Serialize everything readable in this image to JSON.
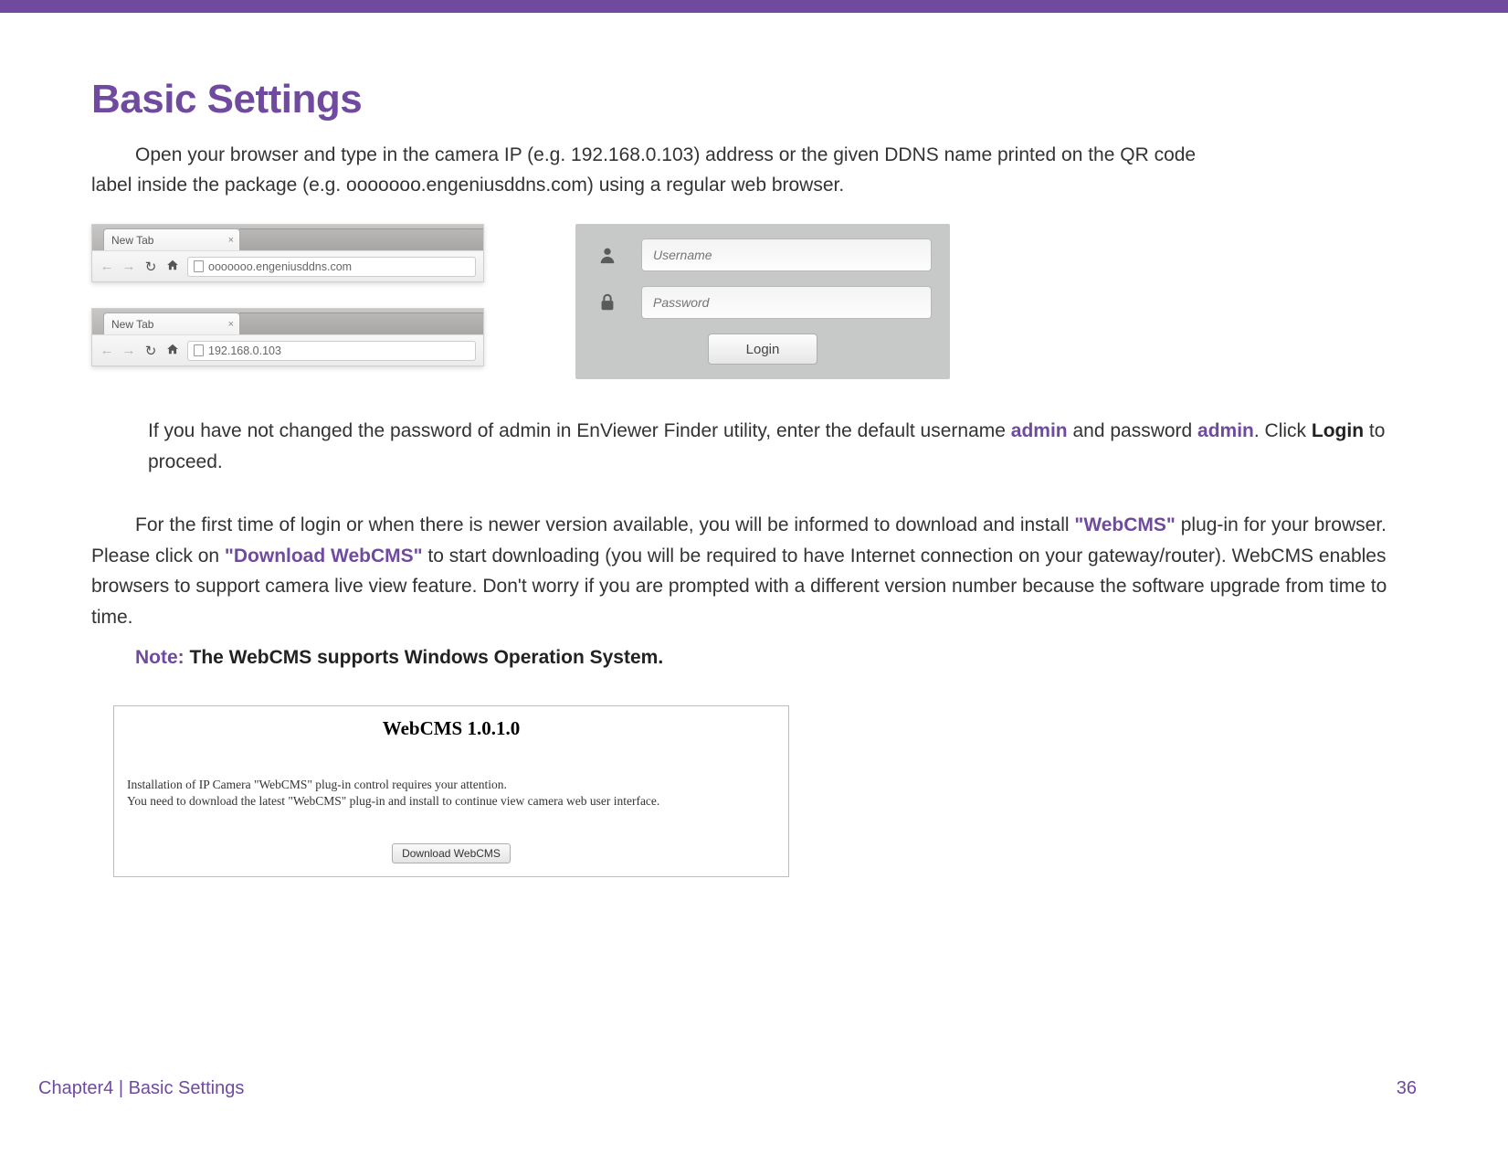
{
  "header": {
    "title": "Basic Settings"
  },
  "intro": {
    "text_a": "Open your browser and type in the camera IP (e.g. 192.168.0.103) address or the given DDNS name printed on the QR code",
    "text_b": "label inside the package (e.g. ooooooo.engeniusddns.com) using a regular web browser."
  },
  "browser1": {
    "tab_label": "New Tab",
    "address": "ooooooo.engeniusddns.com"
  },
  "browser2": {
    "tab_label": "New Tab",
    "address": "192.168.0.103"
  },
  "login": {
    "username_placeholder": "Username",
    "password_placeholder": "Password",
    "button_label": "Login"
  },
  "para2": {
    "a": "If you have not changed the password of admin in EnViewer Finder utility, enter the default username ",
    "admin1": "admin",
    "b": " and password ",
    "admin2": "admin",
    "c": ". Click ",
    "login_word": "Login",
    "d": " to proceed."
  },
  "para3": {
    "a": "For the first time of login or when there is newer version available, you will be informed to download and install ",
    "webcms1": "\"WebCMS\"",
    "b": " plug-in for your browser. Please click on ",
    "download": "\"Download WebCMS\"",
    "c": " to start downloading (you will be required to have Internet connection on your gateway/router). WebCMS enables browsers to support camera live view feature. Don't worry if you are prompted with a different version number because the software upgrade from time to time."
  },
  "note": {
    "label": "Note:",
    "text": " The WebCMS supports Windows Operation System."
  },
  "webcms": {
    "title": "WebCMS 1.0.1.0",
    "line1": "Installation of IP Camera \"WebCMS\" plug-in control requires your attention.",
    "line2": "You need to download the latest \"WebCMS\" plug-in and install to continue view camera web user interface.",
    "button": "Download WebCMS"
  },
  "footer": {
    "left": "Chapter4  |  Basic Settings",
    "page": "36"
  }
}
